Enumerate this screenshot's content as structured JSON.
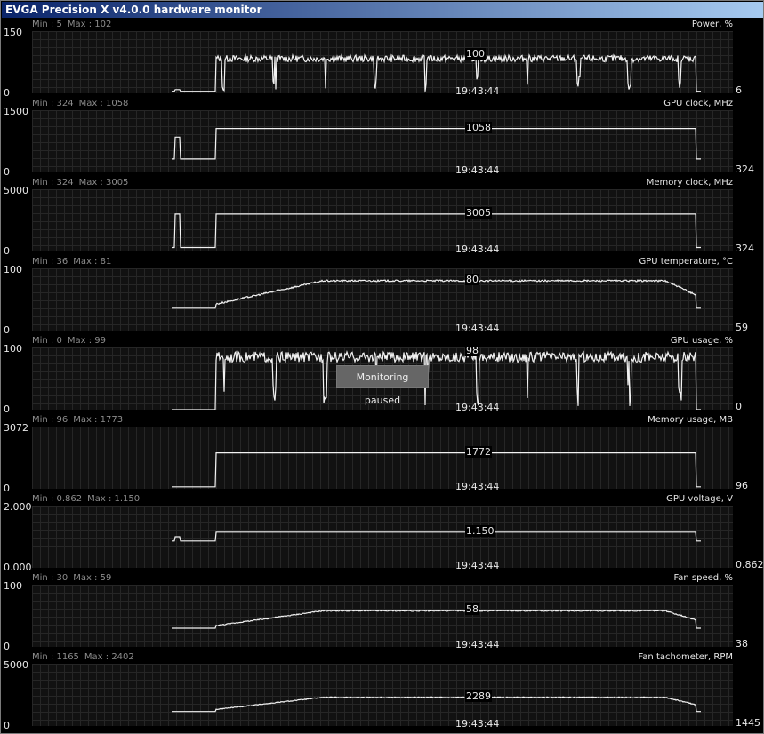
{
  "window": {
    "title": "EVGA Precision X v4.0.0 hardware monitor"
  },
  "monitor": {
    "time": "19:43:44",
    "tooltip": "Monitoring paused",
    "panels": [
      {
        "name": "Power, %",
        "min_label": "Min : 5",
        "max_label": "Max : 102",
        "axis_top": "150",
        "axis_bottom": "0",
        "current": "6",
        "peak": "100",
        "ymax": 150,
        "shape": "noisy",
        "base": 5,
        "level": 92,
        "start": 0.06,
        "spike": 9
      },
      {
        "name": "GPU clock, MHz",
        "min_label": "Min : 324",
        "max_label": "Max : 1058",
        "axis_top": "1500",
        "axis_bottom": "0",
        "current": "324",
        "peak": "1058",
        "ymax": 1500,
        "shape": "flat",
        "base": 324,
        "level": 1058,
        "start": 0.06,
        "spike": 850
      },
      {
        "name": "Memory clock, MHz",
        "min_label": "Min : 324",
        "max_label": "Max : 3005",
        "axis_top": "5000",
        "axis_bottom": "0",
        "current": "324",
        "peak": "3005",
        "ymax": 5000,
        "shape": "flat",
        "base": 324,
        "level": 3005,
        "start": 0.065,
        "spike": 3005
      },
      {
        "name": "GPU temperature, °C",
        "min_label": "Min : 36",
        "max_label": "Max : 81",
        "axis_top": "100",
        "axis_bottom": "0",
        "current": "59",
        "peak": "80",
        "ymax": 100,
        "shape": "smooth",
        "base": 36,
        "level": 80,
        "start": 0.05,
        "spike": 0
      },
      {
        "name": "GPU usage, %",
        "min_label": "Min : 0",
        "max_label": "Max : 99",
        "axis_top": "100",
        "axis_bottom": "0",
        "current": "0",
        "peak": "98",
        "ymax": 100,
        "shape": "noisy",
        "base": 0,
        "level": 93,
        "start": 0.05,
        "spike": 0
      },
      {
        "name": "Memory usage, MB",
        "min_label": "Min : 96",
        "max_label": "Max : 1773",
        "axis_top": "3072",
        "axis_bottom": "0",
        "current": "96",
        "peak": "1772",
        "ymax": 3072,
        "shape": "flat",
        "base": 96,
        "level": 1772,
        "start": 0.05,
        "spike": 0
      },
      {
        "name": "GPU voltage, V",
        "min_label": "Min : 0.862",
        "max_label": "Max : 1.150",
        "axis_top": "2.000",
        "axis_bottom": "0.000",
        "current": "0.862",
        "peak": "1.150",
        "ymax": 2.0,
        "shape": "flat",
        "base": 0.862,
        "level": 1.15,
        "start": 0.06,
        "spike": 1.0
      },
      {
        "name": "Fan speed, %",
        "min_label": "Min : 30",
        "max_label": "Max : 59",
        "axis_top": "100",
        "axis_bottom": "0",
        "current": "38",
        "peak": "58",
        "ymax": 100,
        "shape": "smooth",
        "base": 30,
        "level": 58,
        "start": 0.06,
        "spike": 0
      },
      {
        "name": "Fan tachometer, RPM",
        "min_label": "Min : 1165",
        "max_label": "Max : 2402",
        "axis_top": "5000",
        "axis_bottom": "0",
        "current": "1445",
        "peak": "2289",
        "ymax": 5000,
        "shape": "smooth",
        "base": 1165,
        "level": 2300,
        "start": 0.06,
        "spike": 0
      }
    ]
  }
}
